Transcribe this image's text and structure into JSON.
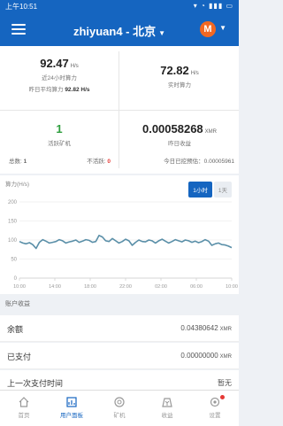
{
  "status_bar": {
    "time": "上午10:51",
    "icons": "▾ ◔ ▮▮▮ ▭"
  },
  "header": {
    "title": "zhiyuan4 - 北京",
    "caret": "▼",
    "coin_symbol": "M",
    "menu_icon": "menu-icon"
  },
  "stats": {
    "hashrate_24h": {
      "value": "92.47",
      "unit": "H/s",
      "label": "近24小时算力"
    },
    "yesterday_avg": {
      "label": "昨日平均算力",
      "value": "92.82 H/s"
    },
    "realtime": {
      "value": "72.82",
      "unit": "H/s",
      "label": "实时算力"
    },
    "active_miners": {
      "value": "1",
      "label": "活跃矿机"
    },
    "total_label": "总数",
    "total_value": "1",
    "inactive_label": "不活跃",
    "inactive_value": "0",
    "yesterday_income": {
      "value": "0.00058268",
      "unit": "XMR",
      "label": "昨日收益"
    },
    "today_paid": "今日已挖预估：0.00005961"
  },
  "chart": {
    "title": "算力(H/s)",
    "buttons": [
      {
        "label": "1小时",
        "active": true
      },
      {
        "label": "1天",
        "active": false
      }
    ]
  },
  "chart_data": {
    "type": "line",
    "title": "",
    "ylabel": "算力(H/s)",
    "xlabel": "",
    "ylim": [
      0,
      200
    ],
    "yticks": [
      "200",
      "150",
      "100",
      "50",
      "0"
    ],
    "xticks": [
      "10:00",
      "14:00",
      "18:00",
      "22:00",
      "02:00",
      "06:00",
      "10:00"
    ],
    "line_color": "#5a8fa8",
    "series": [
      {
        "values": [
          96,
          92,
          90,
          93,
          88,
          78,
          94,
          101,
          97,
          92,
          94,
          96,
          101,
          98,
          92,
          95,
          97,
          100,
          94,
          97,
          101,
          99,
          94,
          96,
          112,
          108,
          98,
          96,
          104,
          98,
          92,
          96,
          102,
          98,
          86,
          94,
          100,
          96,
          95,
          100,
          98,
          92,
          98,
          102,
          97,
          92,
          96,
          101,
          98,
          95,
          100,
          98,
          94,
          97,
          93,
          96,
          101,
          97,
          86,
          90,
          92,
          88,
          87,
          84,
          80
        ]
      }
    ]
  },
  "account": {
    "section_title": "账户收益",
    "rows": [
      {
        "label": "余额",
        "value": "0.04380642",
        "unit": "XMR"
      },
      {
        "label": "已支付",
        "value": "0.00000000",
        "unit": "XMR"
      },
      {
        "label": "上一次支付时间",
        "value": "暂无"
      }
    ]
  },
  "tabs": [
    {
      "label": "首页",
      "icon": "home-icon"
    },
    {
      "label": "用户面板",
      "icon": "dashboard-icon"
    },
    {
      "label": "矿机",
      "icon": "miner-icon"
    },
    {
      "label": "收益",
      "icon": "income-icon"
    },
    {
      "label": "设置",
      "icon": "settings-icon"
    }
  ],
  "colors": {
    "primary": "#1565c0",
    "green": "#2e9e3e",
    "red": "#e53935",
    "monero": "#f26822"
  }
}
